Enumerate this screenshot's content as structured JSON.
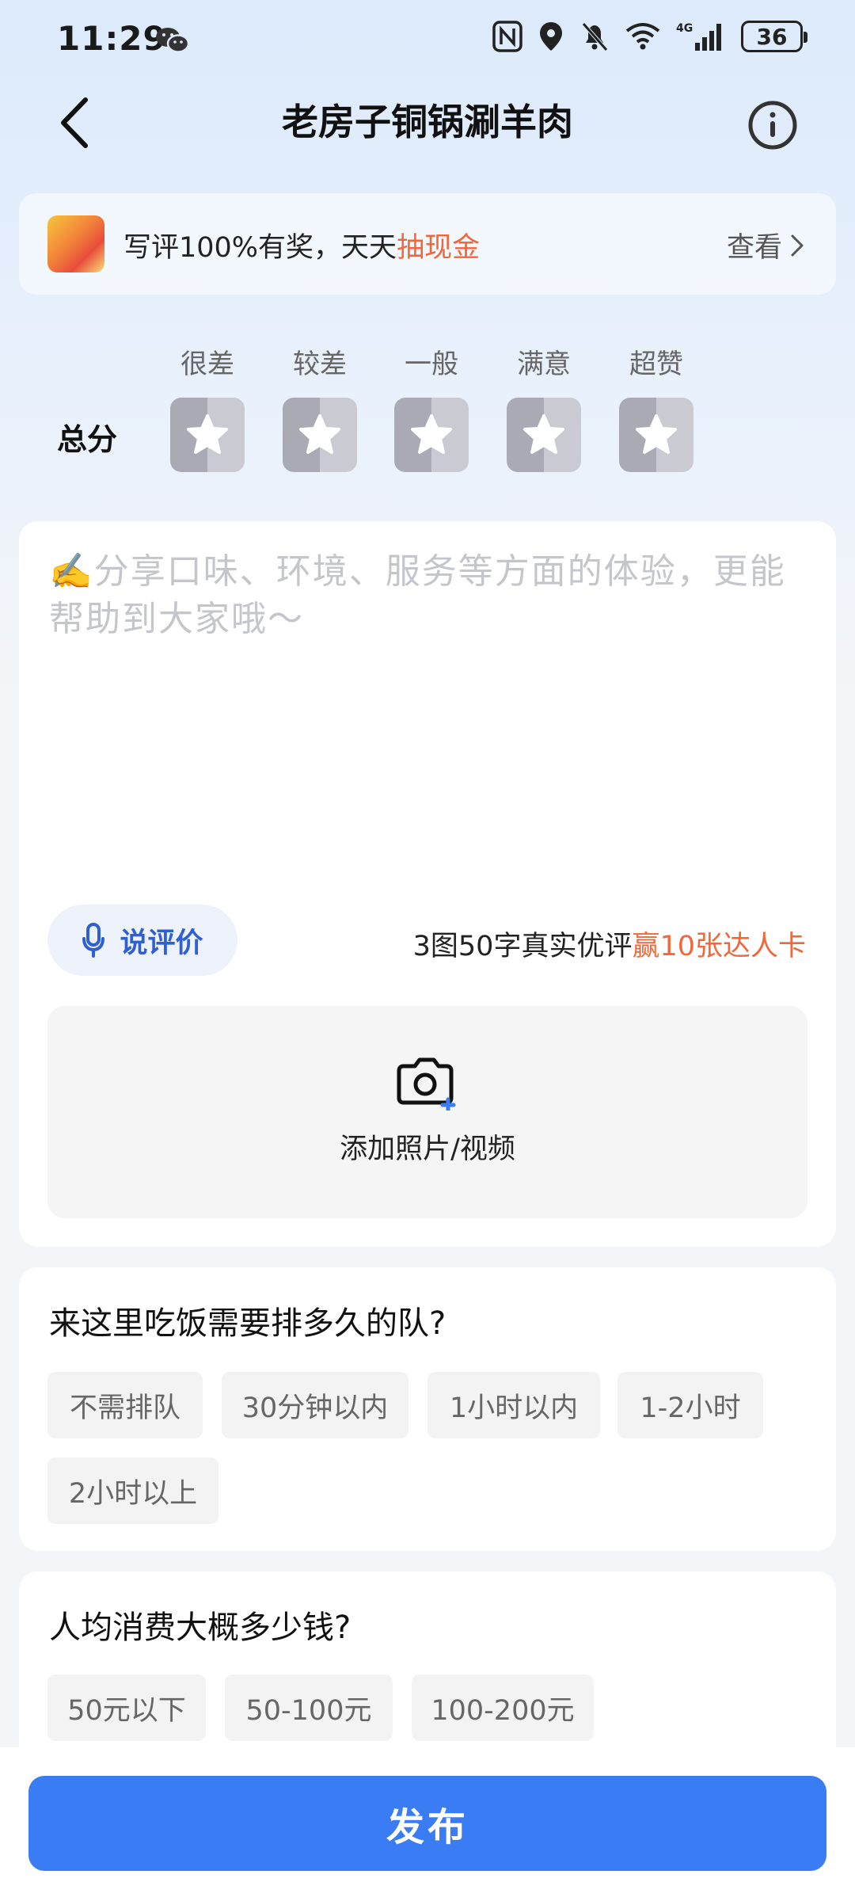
{
  "status_bar": {
    "time": "11:29",
    "battery": "36"
  },
  "header": {
    "title": "老房子铜锅涮羊肉"
  },
  "promo_banner": {
    "text_prefix": "写评100%有奖，天天",
    "text_highlight": "抽现金",
    "view_label": "查看"
  },
  "rating": {
    "total_label": "总分",
    "levels": [
      "很差",
      "较差",
      "一般",
      "满意",
      "超赞"
    ]
  },
  "review": {
    "placeholder": "✍️分享口味、环境、服务等方面的体验，更能帮助到大家哦～",
    "voice_label": "说评价",
    "reward_prefix": "3图50字真实优评",
    "reward_highlight": "赢10张达人卡",
    "upload_label": "添加照片/视频"
  },
  "queue_question": {
    "title": "来这里吃饭需要排多久的队?",
    "options": [
      "不需排队",
      "30分钟以内",
      "1小时以内",
      "1-2小时",
      "2小时以上"
    ]
  },
  "price_question": {
    "title": "人均消费大概多少钱?",
    "options": [
      "50元以下",
      "50-100元",
      "100-200元"
    ]
  },
  "footer": {
    "publish_label": "发布"
  },
  "colors": {
    "accent": "#3a7cf3",
    "highlight": "#f1673a"
  }
}
